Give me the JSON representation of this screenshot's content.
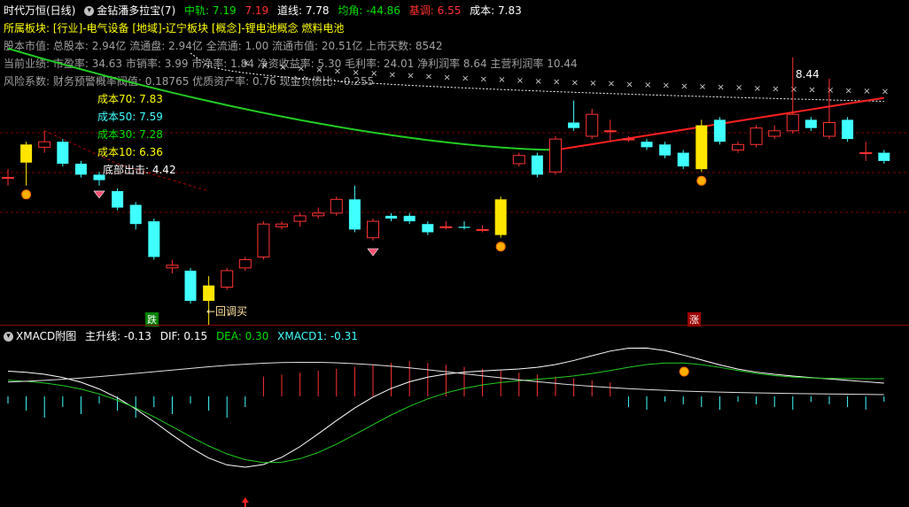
{
  "header": {
    "symbol": "时代万恒(日线)",
    "indicator_name": "金钻潘多拉宝(7)",
    "mid_label": "中轨: 7.19",
    "mid_value2": "7.19",
    "track_label": "道线: 7.78",
    "avg_label": "均角: -44.86",
    "base_label": "基调: 6.55",
    "cost_label": "成本: 7.83"
  },
  "info": {
    "sector": "所属板块: [行业]-电气设备 [地域]-辽宁板块 [概念]-锂电池概念 燃料电池",
    "line1": "股本市值: 总股本: 2.94亿 流通盘: 2.94亿 全流通: 1.00 流通市值: 20.51亿 上市天数: 8542",
    "line2": "当前业绩: 市盈率: 34.63 市销率: 3.99 市净率: 1.84 净资收益率: 5.30 毛利率: 24.01 净利润率 8.64 主营利润率 10.44",
    "line3": "风险系数: 财务预警概率阀值: 0.18765 优质资产率: 0.76 现金负债比: -0.255"
  },
  "cost_labels": {
    "c70": "成本70: 7.83",
    "c50": "成本50: 7.59",
    "c30": "成本30: 7.28",
    "c10": "成本10: 6.36",
    "bottom": "底部出击: 4.42"
  },
  "annotations": {
    "peak": "8.44",
    "buy_point": "←回调买",
    "fall_tag": "跌",
    "rise_tag": "涨"
  },
  "sub": {
    "name": "XMACD附图",
    "main_line": "主升线: -0.13",
    "dif": "DIF: 0.15",
    "dea": "DEA: 0.30",
    "xmacd1": "XMACD1: -0.31"
  },
  "colors": {
    "up": "#ff3232",
    "down": "#40ffff",
    "highlight": "#ffe600",
    "green_line": "#22cc22",
    "red_line": "#ff2020",
    "background": "#000000"
  },
  "chart_data": {
    "type": "candlestick",
    "ylim": [
      4.0,
      9.0
    ],
    "candles": [
      {
        "o": 6.25,
        "c": 6.25,
        "h": 6.4,
        "l": 6.1
      },
      {
        "o": 6.52,
        "c": 6.85,
        "h": 6.9,
        "l": 6.1,
        "hl": true
      },
      {
        "o": 6.8,
        "c": 6.9,
        "h": 7.1,
        "l": 6.7
      },
      {
        "o": 6.9,
        "c": 6.5,
        "h": 6.95,
        "l": 6.45
      },
      {
        "o": 6.5,
        "c": 6.3,
        "h": 6.55,
        "l": 6.25
      },
      {
        "o": 6.3,
        "c": 6.2,
        "h": 6.35,
        "l": 6.1
      },
      {
        "o": 6.0,
        "c": 5.7,
        "h": 6.05,
        "l": 5.65
      },
      {
        "o": 5.75,
        "c": 5.4,
        "h": 5.8,
        "l": 5.3
      },
      {
        "o": 5.45,
        "c": 4.8,
        "h": 5.5,
        "l": 4.75
      },
      {
        "o": 4.6,
        "c": 4.65,
        "h": 4.75,
        "l": 4.5
      },
      {
        "o": 4.55,
        "c": 4.0,
        "h": 4.6,
        "l": 3.95
      },
      {
        "o": 4.0,
        "c": 4.28,
        "h": 4.45,
        "l": 3.35,
        "hl": true
      },
      {
        "o": 4.25,
        "c": 4.55,
        "h": 4.6,
        "l": 4.2
      },
      {
        "o": 4.6,
        "c": 4.75,
        "h": 4.8,
        "l": 4.55
      },
      {
        "o": 4.8,
        "c": 5.4,
        "h": 5.45,
        "l": 4.75
      },
      {
        "o": 5.35,
        "c": 5.4,
        "h": 5.45,
        "l": 5.3
      },
      {
        "o": 5.45,
        "c": 5.55,
        "h": 5.6,
        "l": 5.35
      },
      {
        "o": 5.55,
        "c": 5.6,
        "h": 5.7,
        "l": 5.5
      },
      {
        "o": 5.6,
        "c": 5.85,
        "h": 5.9,
        "l": 5.55
      },
      {
        "o": 5.85,
        "c": 5.3,
        "h": 6.1,
        "l": 5.25
      },
      {
        "o": 5.15,
        "c": 5.45,
        "h": 5.5,
        "l": 5.1
      },
      {
        "o": 5.55,
        "c": 5.5,
        "h": 5.6,
        "l": 5.45
      },
      {
        "o": 5.55,
        "c": 5.45,
        "h": 5.6,
        "l": 5.4
      },
      {
        "o": 5.4,
        "c": 5.25,
        "h": 5.45,
        "l": 5.2
      },
      {
        "o": 5.35,
        "c": 5.35,
        "h": 5.45,
        "l": 5.3
      },
      {
        "o": 5.35,
        "c": 5.33,
        "h": 5.45,
        "l": 5.3
      },
      {
        "o": 5.3,
        "c": 5.3,
        "h": 5.38,
        "l": 5.25
      },
      {
        "o": 5.2,
        "c": 5.85,
        "h": 5.9,
        "l": 5.15,
        "hl": true
      },
      {
        "o": 6.5,
        "c": 6.65,
        "h": 6.7,
        "l": 6.45
      },
      {
        "o": 6.65,
        "c": 6.3,
        "h": 6.7,
        "l": 6.25
      },
      {
        "o": 6.35,
        "c": 6.95,
        "h": 7.0,
        "l": 6.3
      },
      {
        "o": 7.25,
        "c": 7.15,
        "h": 7.65,
        "l": 7.1
      },
      {
        "o": 7.0,
        "c": 7.4,
        "h": 7.5,
        "l": 6.95
      },
      {
        "o": 7.1,
        "c": 7.1,
        "h": 7.3,
        "l": 6.9
      },
      {
        "o": 6.95,
        "c": 6.95,
        "h": 7.0,
        "l": 6.9
      },
      {
        "o": 6.9,
        "c": 6.8,
        "h": 6.95,
        "l": 6.75
      },
      {
        "o": 6.85,
        "c": 6.65,
        "h": 6.9,
        "l": 6.6
      },
      {
        "o": 6.7,
        "c": 6.45,
        "h": 6.75,
        "l": 6.4
      },
      {
        "o": 6.4,
        "c": 7.2,
        "h": 7.3,
        "l": 6.35,
        "hl": true
      },
      {
        "o": 7.3,
        "c": 6.9,
        "h": 7.35,
        "l": 6.85
      },
      {
        "o": 6.75,
        "c": 6.85,
        "h": 6.9,
        "l": 6.7
      },
      {
        "o": 6.85,
        "c": 7.15,
        "h": 7.2,
        "l": 6.8
      },
      {
        "o": 7.0,
        "c": 7.1,
        "h": 7.2,
        "l": 6.95
      },
      {
        "o": 7.1,
        "c": 7.4,
        "h": 8.44,
        "l": 7.05
      },
      {
        "o": 7.3,
        "c": 7.15,
        "h": 7.35,
        "l": 7.1
      },
      {
        "o": 7.0,
        "c": 7.25,
        "h": 8.05,
        "l": 6.95
      },
      {
        "o": 7.3,
        "c": 6.95,
        "h": 7.35,
        "l": 6.9
      },
      {
        "o": 6.7,
        "c": 6.7,
        "h": 6.9,
        "l": 6.55
      },
      {
        "o": 6.7,
        "c": 6.55,
        "h": 6.75,
        "l": 6.5
      }
    ]
  }
}
